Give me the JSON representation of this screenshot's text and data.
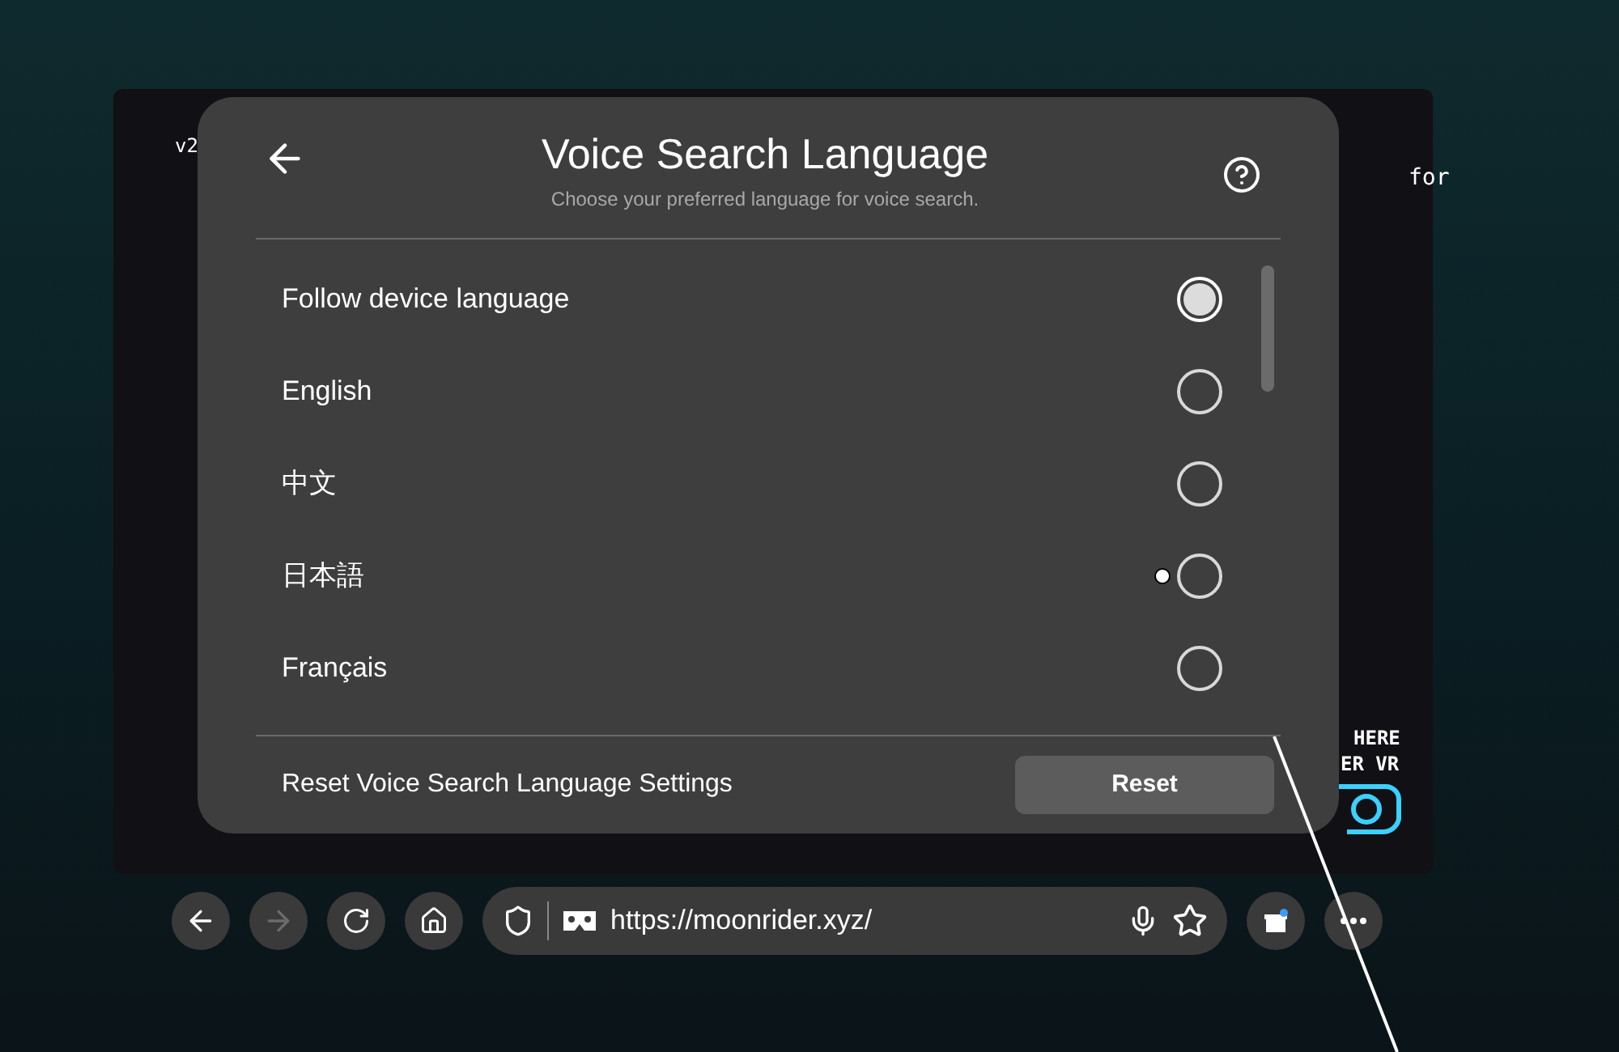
{
  "background_page": {
    "texts": [
      "v2",
      "for",
      "HERE",
      "ER VR"
    ]
  },
  "dialog": {
    "title": "Voice Search Language",
    "subtitle": "Choose your preferred language for voice search.",
    "options": [
      {
        "label": "Follow device language",
        "selected": true
      },
      {
        "label": "English",
        "selected": false
      },
      {
        "label": "中文",
        "selected": false
      },
      {
        "label": "日本語",
        "selected": false
      },
      {
        "label": "Français",
        "selected": false
      }
    ],
    "reset_label": "Reset Voice Search Language Settings",
    "reset_button": "Reset"
  },
  "toolbar": {
    "back_disabled": false,
    "forward_disabled": true,
    "url": "https://moonrider.xyz/"
  }
}
